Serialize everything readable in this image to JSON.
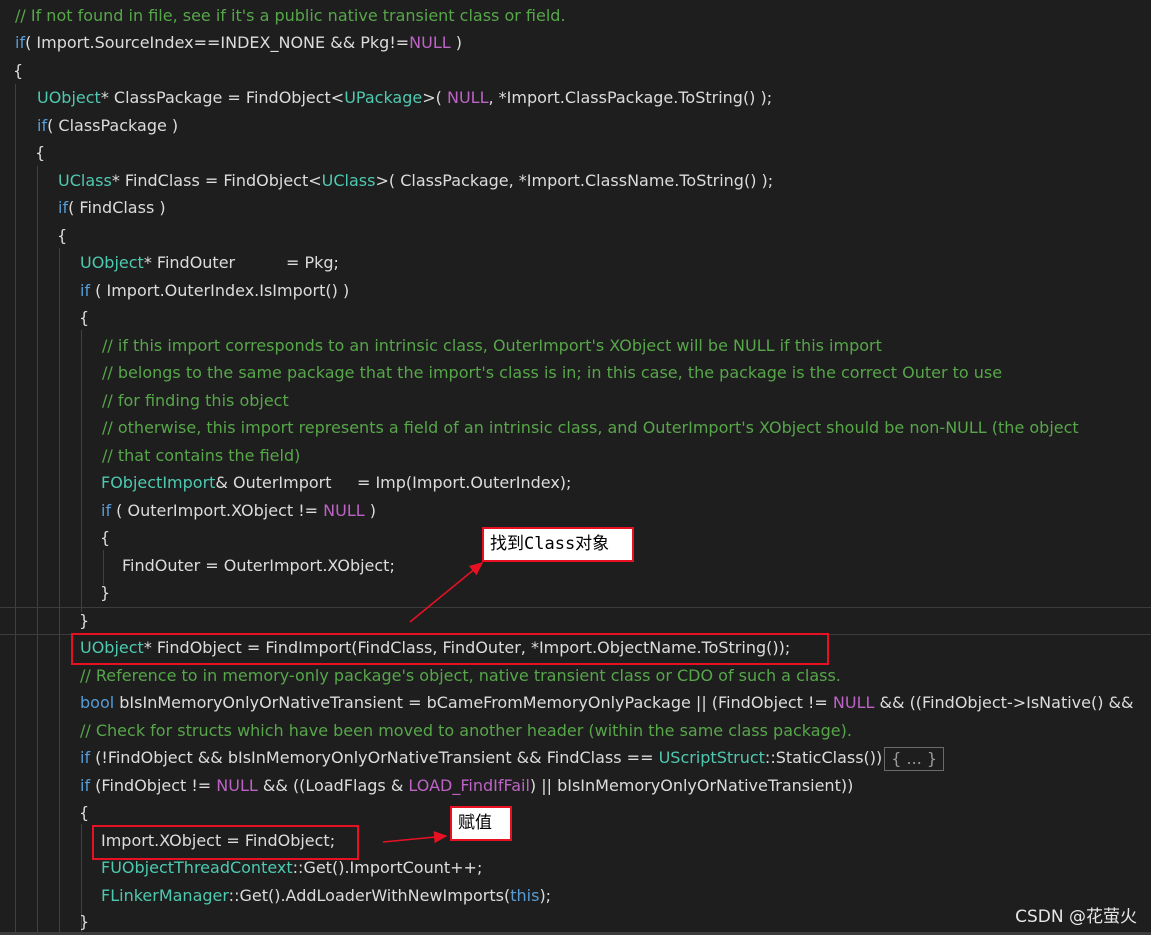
{
  "code": {
    "l1": "// If not found in file, see if it's a public native transient class or field.",
    "l2": [
      "if",
      "( Import.SourceIndex==INDEX_NONE && Pkg!=",
      "NULL",
      " )"
    ],
    "l3": "{",
    "l4": [
      "UObject",
      "* ClassPackage = FindObject<",
      "UPackage",
      ">( ",
      "NULL",
      ", *Import.ClassPackage.ToString() );"
    ],
    "l5": [
      "if",
      "( ClassPackage )"
    ],
    "l6": "{",
    "l7": [
      "UClass",
      "* FindClass = FindObject<",
      "UClass",
      ">( ClassPackage, *Import.ClassName.ToString() );"
    ],
    "l8": [
      "if",
      "( FindClass )"
    ],
    "l9": "{",
    "l10": [
      "UObject",
      "* FindOuter          = Pkg;"
    ],
    "l11": [
      "if",
      " ( Import.OuterIndex.IsImport() )"
    ],
    "l12": "{",
    "l13": "// if this import corresponds to an intrinsic class, OuterImport's XObject will be NULL if this import",
    "l14": "// belongs to the same package that the import's class is in; in this case, the package is the correct Outer to use",
    "l15": "// for finding this object",
    "l16": "// otherwise, this import represents a field of an intrinsic class, and OuterImport's XObject should be non-NULL (the object",
    "l17": "// that contains the field)",
    "l18": [
      "FObjectImport",
      "& OuterImport     = Imp(Import.OuterIndex);"
    ],
    "l19": [
      "if",
      " ( OuterImport.XObject != ",
      "NULL",
      " )"
    ],
    "l20": "{",
    "l21": "FindOuter = OuterImport.XObject;",
    "l22": "}",
    "l23": "}",
    "l24": [
      "UObject",
      "* FindObject = FindImport(FindClass, FindOuter, *Import.ObjectName.ToString());"
    ],
    "l25": "// Reference to in memory-only package's object, native transient class or CDO of such a class.",
    "l26": [
      "bool",
      " bIsInMemoryOnlyOrNativeTransient = bCameFromMemoryOnlyPackage || (FindObject != ",
      "NULL",
      " && ((FindObject->IsNative() &&"
    ],
    "l27": "// Check for structs which have been moved to another header (within the same class package).",
    "l28": [
      "if",
      " (!FindObject && bIsInMemoryOnlyOrNativeTransient && FindClass == ",
      "UScriptStruct",
      "::StaticClass())",
      "{ ... }"
    ],
    "l29": [
      "if",
      " (FindObject != ",
      "NULL",
      " && ((LoadFlags & ",
      "LOAD_FindIfFail",
      ") || bIsInMemoryOnlyOrNativeTransient))"
    ],
    "l30": "{",
    "l31": "Import.XObject = FindObject;",
    "l32": [
      "FUObjectThreadContext",
      "::Get().ImportCount++;"
    ],
    "l33": [
      "FLinkerManager",
      "::Get().AddLoaderWithNewImports(",
      "this",
      ");"
    ],
    "l34": "}"
  },
  "annotations": {
    "note1": "找到Class对象",
    "note2": "赋值"
  },
  "watermark": "CSDN @花萤火",
  "colors": {
    "background": "#1e1e1e",
    "comment": "#57a64a",
    "keyword": "#569cd6",
    "type": "#4ec9b0",
    "macro": "#bd63c5",
    "annotation_border": "#e81123"
  }
}
